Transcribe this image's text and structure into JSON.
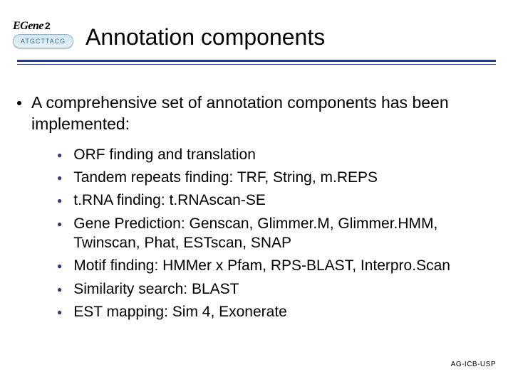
{
  "logo": {
    "name": "EGene",
    "suffix": "2",
    "capsule_text": "ATGCTTACG"
  },
  "title": "Annotation components",
  "intro": "A comprehensive set of annotation components has been implemented:",
  "items": [
    "ORF finding and translation",
    "Tandem repeats finding: TRF, String, m.REPS",
    "t.RNA finding: t.RNAscan-SE",
    "Gene Prediction: Genscan, Glimmer.M, Glimmer.HMM, Twinscan, Phat, ESTscan, SNAP",
    "Motif finding: HMMer x Pfam, RPS-BLAST, Interpro.Scan",
    "Similarity search: BLAST",
    "EST mapping: Sim 4, Exonerate"
  ],
  "footer": "AG-ICB-USP"
}
